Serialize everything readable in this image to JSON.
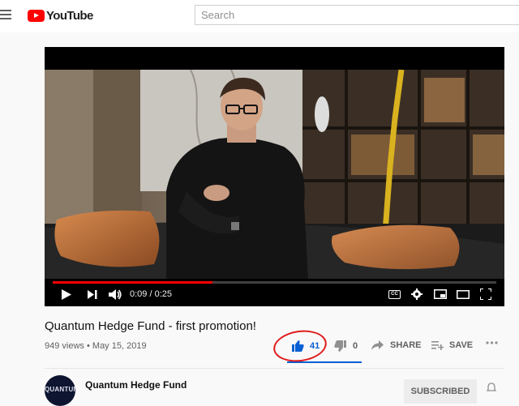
{
  "header": {
    "logo_text": "YouTube",
    "search_placeholder": "Search",
    "menu_icon": "hamburger-icon"
  },
  "player": {
    "current_time": "0:09",
    "duration": "0:25",
    "time_display": "0:09 / 0:25",
    "progress_fraction": 0.36,
    "icons": [
      "play-icon",
      "next-icon",
      "volume-icon",
      "captions-icon",
      "settings-icon",
      "miniplayer-icon",
      "theater-icon",
      "fullscreen-icon"
    ],
    "captions_label": "CC"
  },
  "video": {
    "title": "Quantum Hedge Fund - first promotion!",
    "views": "949 views",
    "separator": "•",
    "date": "May 15, 2019"
  },
  "actions": {
    "likes": "41",
    "dislikes": "0",
    "share_label": "SHARE",
    "save_label": "SAVE",
    "like_ratio": 1.0
  },
  "channel": {
    "name": "Quantum Hedge Fund",
    "avatar_text": "QUANTUM",
    "subscribe_label": "SUBSCRIBED"
  },
  "colors": {
    "brand_red": "#ff0000",
    "like_blue": "#065fd4",
    "annotation_circle": "#e01b1b"
  }
}
